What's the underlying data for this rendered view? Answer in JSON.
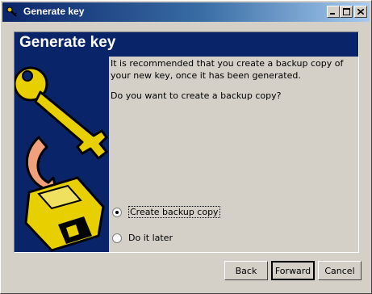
{
  "window": {
    "title": "Generate key"
  },
  "banner": {
    "title": "Generate key"
  },
  "body": {
    "instruction": "It is recommended that you create a backup copy of your new key, once it has been generated.",
    "question": "Do you want to create a backup copy?"
  },
  "options": [
    {
      "label": "Create backup copy",
      "selected": true
    },
    {
      "label": "Do it later",
      "selected": false
    }
  ],
  "buttons": {
    "back": "Back",
    "forward": "Forward",
    "cancel": "Cancel"
  },
  "colors": {
    "banner_bg": "#0a246a",
    "dialog_bg": "#d4d0c8"
  }
}
